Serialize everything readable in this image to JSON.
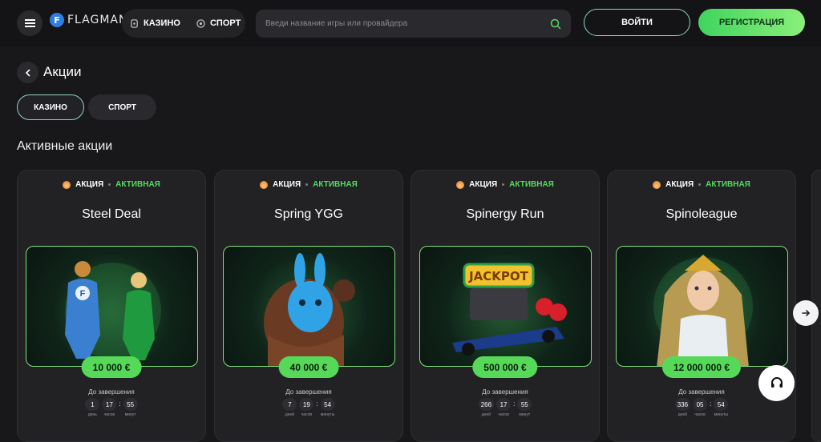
{
  "header": {
    "logo_letter": "F",
    "logo_text": "FLAGMAN",
    "nav": [
      {
        "label": "КАЗИНО",
        "icon": "casino-icon"
      },
      {
        "label": "СПОРТ",
        "icon": "ball-icon"
      }
    ],
    "search_placeholder": "Введи название игры или провайдера",
    "login_label": "ВОЙТИ",
    "register_label": "РЕГИСТРАЦИЯ"
  },
  "page": {
    "title": "Акции",
    "tabs": [
      {
        "label": "КАЗИНО",
        "active": true
      },
      {
        "label": "СПОРТ",
        "active": false
      }
    ],
    "section_title": "Активные акции"
  },
  "cards": [
    {
      "tag": "АКЦИЯ",
      "status": "АКТИВНАЯ",
      "title": "Steel Deal",
      "prize": "10 000 €",
      "until": "До завершения",
      "timer": [
        {
          "v": "1",
          "l": "день"
        },
        {
          "v": "17",
          "l": "часов"
        },
        {
          "v": "55",
          "l": "минут"
        }
      ]
    },
    {
      "tag": "АКЦИЯ",
      "status": "АКТИВНАЯ",
      "title": "Spring YGG",
      "prize": "40 000 €",
      "until": "До завершения",
      "timer": [
        {
          "v": "7",
          "l": "дней"
        },
        {
          "v": "19",
          "l": "часов"
        },
        {
          "v": "54",
          "l": "минуты"
        }
      ]
    },
    {
      "tag": "АКЦИЯ",
      "status": "АКТИВНАЯ",
      "title": "Spinergy Run",
      "prize": "500 000 €",
      "until": "До завершения",
      "timer": [
        {
          "v": "266",
          "l": "дней"
        },
        {
          "v": "17",
          "l": "часов"
        },
        {
          "v": "55",
          "l": "минут"
        }
      ]
    },
    {
      "tag": "АКЦИЯ",
      "status": "АКТИВНАЯ",
      "title": "Spinoleague",
      "prize": "12 000 000 €",
      "until": "До завершения",
      "timer": [
        {
          "v": "336",
          "l": "дней"
        },
        {
          "v": "05",
          "l": "часов"
        },
        {
          "v": "54",
          "l": "минуты"
        }
      ]
    }
  ],
  "art": {
    "jackpot_text": "JACKPOT",
    "hero_letter": "F"
  },
  "colors": {
    "accent_green": "#56d959",
    "status_green": "#57d860",
    "outline_teal": "#8fd3c0",
    "background": "#18181a"
  }
}
